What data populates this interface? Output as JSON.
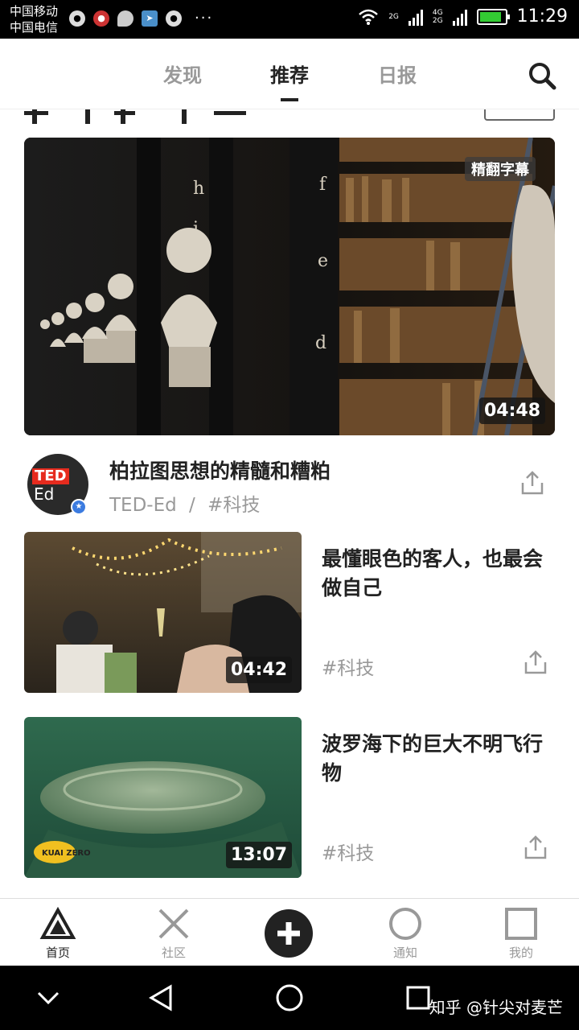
{
  "status_bar": {
    "carrier1": "中国移动",
    "carrier2": "中国电信",
    "network1": "2G",
    "network2": "4G",
    "network3": "2G",
    "more": "···",
    "time": "11:29"
  },
  "top_nav": {
    "tabs": [
      {
        "label": "发现"
      },
      {
        "label": "推荐"
      },
      {
        "label": "日报"
      }
    ],
    "active_tab": "推荐"
  },
  "featured": {
    "subtitle_badge": "精翻字幕",
    "duration": "04:48",
    "title": "柏拉图思想的精髓和糟粕",
    "channel": "TED-Ed",
    "separator": "/",
    "tag": "#科技",
    "avatar_text1": "TED",
    "avatar_text2": "Ed"
  },
  "videos": [
    {
      "title": "最懂眼色的客人，也最会做自己",
      "tag": "#科技",
      "duration": "04:42"
    },
    {
      "title": "波罗海下的巨大不明飞行物",
      "tag": "#科技",
      "duration": "13:07",
      "logo": "KUAI ZERO"
    }
  ],
  "bottom_nav": {
    "items": [
      {
        "label": "首页"
      },
      {
        "label": "社区"
      },
      {
        "label": "通知"
      },
      {
        "label": "我的"
      }
    ]
  },
  "watermark": "知乎 @针尖对麦芒",
  "colors": {
    "text": "#222222",
    "muted": "#999999",
    "ted_red": "#e62b1e",
    "verify_blue": "#3b7be0"
  }
}
